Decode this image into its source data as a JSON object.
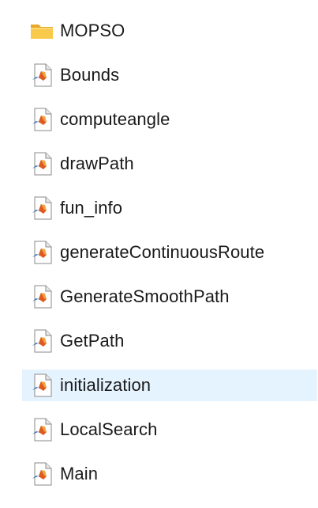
{
  "items": [
    {
      "label": "MOPSO",
      "icon": "folder-icon",
      "selected": false
    },
    {
      "label": "Bounds",
      "icon": "matlab-file-icon",
      "selected": false
    },
    {
      "label": "computeangle",
      "icon": "matlab-file-icon",
      "selected": false
    },
    {
      "label": "drawPath",
      "icon": "matlab-file-icon",
      "selected": false
    },
    {
      "label": "fun_info",
      "icon": "matlab-file-icon",
      "selected": false
    },
    {
      "label": "generateContinuousRoute",
      "icon": "matlab-file-icon",
      "selected": false
    },
    {
      "label": "GenerateSmoothPath",
      "icon": "matlab-file-icon",
      "selected": false
    },
    {
      "label": "GetPath",
      "icon": "matlab-file-icon",
      "selected": false
    },
    {
      "label": "initialization",
      "icon": "matlab-file-icon",
      "selected": true
    },
    {
      "label": "LocalSearch",
      "icon": "matlab-file-icon",
      "selected": false
    },
    {
      "label": "Main",
      "icon": "matlab-file-icon",
      "selected": false
    }
  ],
  "colors": {
    "selection": "#e5f3ff",
    "folder": "#f8c94a",
    "text": "#1a1a1a"
  }
}
